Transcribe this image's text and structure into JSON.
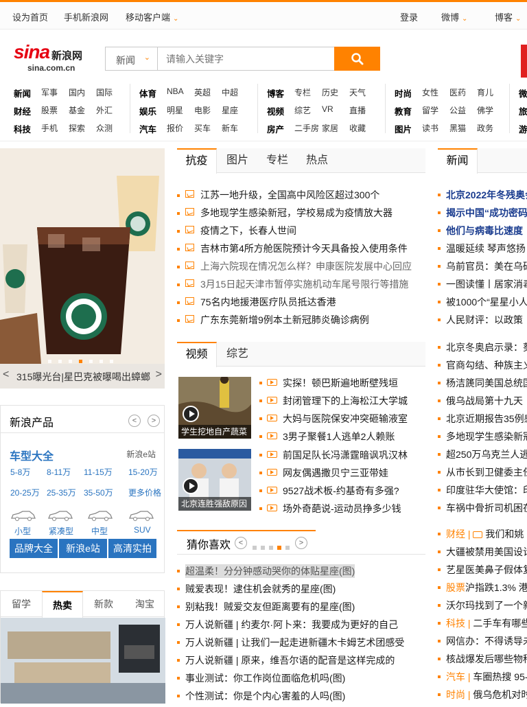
{
  "topbar": {
    "set_home": "设为首页",
    "mobile_sina": "手机新浪网",
    "mobile_client": "移动客户端",
    "login": "登录",
    "weibo": "微博",
    "blog": "博客"
  },
  "logo": {
    "main": "sina",
    "cn": "新浪网",
    "domain": "sina.com.cn"
  },
  "search": {
    "category": "新闻",
    "placeholder": "请输入关键字"
  },
  "nav": {
    "g1": [
      "新闻",
      "军事",
      "国内",
      "国际",
      "财经",
      "股票",
      "基金",
      "外汇",
      "科技",
      "手机",
      "探索",
      "众测"
    ],
    "g2": [
      "体育",
      "NBA",
      "英超",
      "中超",
      "娱乐",
      "明星",
      "电影",
      "星座",
      "汽车",
      "报价",
      "买车",
      "新车"
    ],
    "g3": [
      "博客",
      "专栏",
      "历史",
      "天气",
      "视频",
      "综艺",
      "VR",
      "直播",
      "房产",
      "二手房",
      "家居",
      "收藏"
    ],
    "g4": [
      "时尚",
      "女性",
      "医药",
      "育儿",
      "教育",
      "留学",
      "公益",
      "佛学",
      "图片",
      "读书",
      "黑猫",
      "政务"
    ],
    "g5": [
      "微",
      "旅",
      "游"
    ]
  },
  "slider": {
    "caption": "315曝光台|星巴克被曝喝出蟑螂",
    "prev": "<",
    "next": ">"
  },
  "products": {
    "title": "新浪产品",
    "car_title": "车型大全",
    "estation": "新浪e站",
    "prices": [
      "5-8万",
      "8-11万",
      "11-15万",
      "15-20万",
      "20-25万",
      "25-35万",
      "35-50万",
      "更多价格"
    ],
    "car_types": [
      "小型",
      "紧凑型",
      "中型",
      "SUV"
    ],
    "buttons": [
      "品牌大全",
      "新浪e站",
      "高清实拍"
    ]
  },
  "hot": {
    "tabs": [
      "留学",
      "热卖",
      "新款",
      "淘宝"
    ],
    "active": "热卖"
  },
  "news_tabs": [
    "抗疫",
    "图片",
    "专栏",
    "热点"
  ],
  "news": [
    "江苏一地升级，全国高中风险区超过300个",
    "多地现学生感染新冠，学校易成为疫情放大器",
    "疫情之下，长春人世间",
    "吉林市第4所方舱医院预计今天具备投入使用条件",
    "上海六院现在情况怎么样？申康医院发展中心回应",
    "3月15日起天津市暂停实施机动车尾号限行等措施",
    "75名内地援港医疗队员抵达香港",
    "广东东莞新增9例本土新冠肺炎确诊病例"
  ],
  "video_tabs": [
    "视频",
    "综艺"
  ],
  "videos": [
    "实探！顿巴斯遍地断壁残垣",
    "封闭管理下的上海松江大学城",
    "大妈与医院保安冲突砸输液室",
    "3男子聚餐1人逃单2人赖账",
    "前国足队长冯潇霆暗讽巩汉林",
    "网友偶遇撒贝宁三亚带娃",
    "9527战术板-约基奇有多强?",
    "场外奇葩说-运动员挣多少钱"
  ],
  "video_thumbs": [
    "学生挖地自产蔬菜",
    "北京连胜强敌原因"
  ],
  "guess": {
    "title": "猜你喜欢",
    "items": [
      "超温柔！分分钟感动哭你的体贴星座(图)",
      "贼爱表现！逮住机会就秀的星座(图)",
      "别粘我！贼爱交友但距离要有的星座(图)",
      "万人说新疆 | 约麦尔·阿卜来：我要成为更好的自己",
      "万人说新疆 | 让我们一起走进新疆木卡姆艺术团感受",
      "万人说新疆 | 原来，维吾尔语的配音是这样完成的",
      "事业测试：你工作岗位面临危机吗(图)",
      "个性测试：你是个内心害羞的人吗(图)"
    ]
  },
  "col3": {
    "tab": "新闻",
    "items": [
      {
        "text": "北京2022年冬残奥会",
        "bold": true
      },
      {
        "text": "揭示中国“成功密码",
        "bold": true
      },
      {
        "text": "他们与病毒比速度 ",
        "bold": true
      },
      {
        "text": "温暖延续 琴声悠扬"
      },
      {
        "text": "乌前官员：美在乌研"
      },
      {
        "text": "一图读懂丨居家消毒"
      },
      {
        "text": "被1000个“星星小人"
      },
      {
        "text": "人民财评：以政策"
      },
      {
        "text": "北京冬奥启示录：葵"
      },
      {
        "text": "官商勾结、种族主义"
      },
      {
        "text": "杨洁篪同美国总统国"
      },
      {
        "text": "俄乌战局第十九天 "
      },
      {
        "text": "北京近期报告35例感"
      },
      {
        "text": "多地现学生感染新冠"
      },
      {
        "text": "超250万乌克兰人逃"
      },
      {
        "text": "从市长到卫健委主任"
      },
      {
        "text": "印度驻华大使馆：印"
      },
      {
        "text": "车祸中骨折司机困在"
      },
      {
        "tag": "财经 | ",
        "text": "我们和姚"
      },
      {
        "text": "大疆被禁用美国设计"
      },
      {
        "text": "艺星医美鼻子假体复"
      },
      {
        "tag": "股票",
        "text": "沪指跌1.3% 港"
      },
      {
        "text": "沃尔玛找到了一个新"
      },
      {
        "tag": "科技 | ",
        "text": "二手车有哪些"
      },
      {
        "text": "网信办：不得诱导未"
      },
      {
        "text": "核战爆发后哪些物种"
      },
      {
        "tag": "汽车 | ",
        "text": "车圈热搜 95-"
      },
      {
        "tag": "时尚 | ",
        "text": "俄乌危机对时"
      }
    ]
  },
  "colors": {
    "accent": "#ff8200",
    "link_blue": "#2a74c0",
    "headline_blue": "#1a3c8f"
  }
}
